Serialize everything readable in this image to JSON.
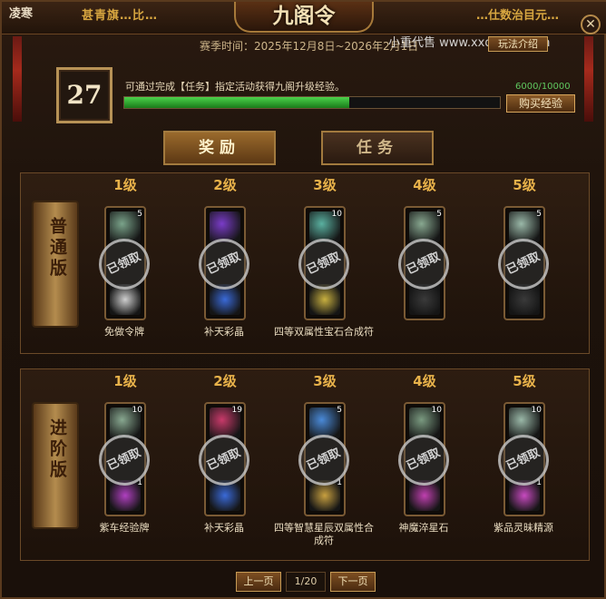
{
  "top": {
    "left_label": "凌寒",
    "ribbon_left": "甚青旗…比…",
    "ribbon_right": "…仕数治目元…",
    "title": "九阁令",
    "close_icon": "close-icon"
  },
  "season": {
    "text": "赛季时间：2025年12月8日~2026年2月1日",
    "watermark": "小重代售 www.xxdc727.com",
    "rules_button": "玩法介绍"
  },
  "progress": {
    "level": "27",
    "hint": "可通过完成【任务】指定活动获得九阁升级经验。",
    "exp_text": "6000/10000",
    "exp_fraction": 0.6,
    "buy_button": "购买经验"
  },
  "tabs": [
    {
      "label": "奖励",
      "active": true
    },
    {
      "label": "任务",
      "active": false
    }
  ],
  "tracks": [
    {
      "name": "普通版",
      "levels": [
        {
          "label": "1级",
          "top_qty": "5",
          "bot_qty": "",
          "stamp": "已领取",
          "item_name": "免做令牌",
          "top_color": "#7aa38a",
          "bot_color": "#cfcfcf"
        },
        {
          "label": "2级",
          "top_qty": "",
          "bot_qty": "",
          "stamp": "已领取",
          "item_name": "补天彩晶",
          "top_color": "#7a3cc8",
          "bot_color": "#3a6ad8"
        },
        {
          "label": "3级",
          "top_qty": "10",
          "bot_qty": "",
          "stamp": "已领取",
          "item_name": "四等双属性宝石合成符",
          "top_color": "#5ab0a0",
          "bot_color": "#c8b040"
        },
        {
          "label": "4级",
          "top_qty": "5",
          "bot_qty": "",
          "stamp": "已领取",
          "item_name": "",
          "top_color": "#88a890",
          "bot_color": "#3a3a3a"
        },
        {
          "label": "5级",
          "top_qty": "5",
          "bot_qty": "",
          "stamp": "已领取",
          "item_name": "",
          "top_color": "#9ab8a8",
          "bot_color": "#3a3a3a"
        }
      ]
    },
    {
      "name": "进阶版",
      "levels": [
        {
          "label": "1级",
          "top_qty": "10",
          "bot_qty": "1",
          "stamp": "已领取",
          "item_name": "紫车经验牌",
          "top_color": "#88a890",
          "bot_color": "#b040c0"
        },
        {
          "label": "2级",
          "top_qty": "19",
          "bot_qty": "",
          "stamp": "已领取",
          "item_name": "补天彩晶",
          "top_color": "#c83a6a",
          "bot_color": "#3a6ad8"
        },
        {
          "label": "3级",
          "top_qty": "5",
          "bot_qty": "1",
          "stamp": "已领取",
          "item_name": "四等智慧星辰双属性合成符",
          "top_color": "#4a8ad8",
          "bot_color": "#c8a040"
        },
        {
          "label": "4级",
          "top_qty": "10",
          "bot_qty": "",
          "stamp": "已领取",
          "item_name": "神魔淬星石",
          "top_color": "#7a9a80",
          "bot_color": "#c040b0"
        },
        {
          "label": "5级",
          "top_qty": "10",
          "bot_qty": "1",
          "stamp": "已领取",
          "item_name": "紫品灵昧精源",
          "top_color": "#9ab8a8",
          "bot_color": "#c84ac0"
        }
      ]
    }
  ],
  "pager": {
    "prev": "上一页",
    "page": "1/20",
    "next": "下一页"
  }
}
